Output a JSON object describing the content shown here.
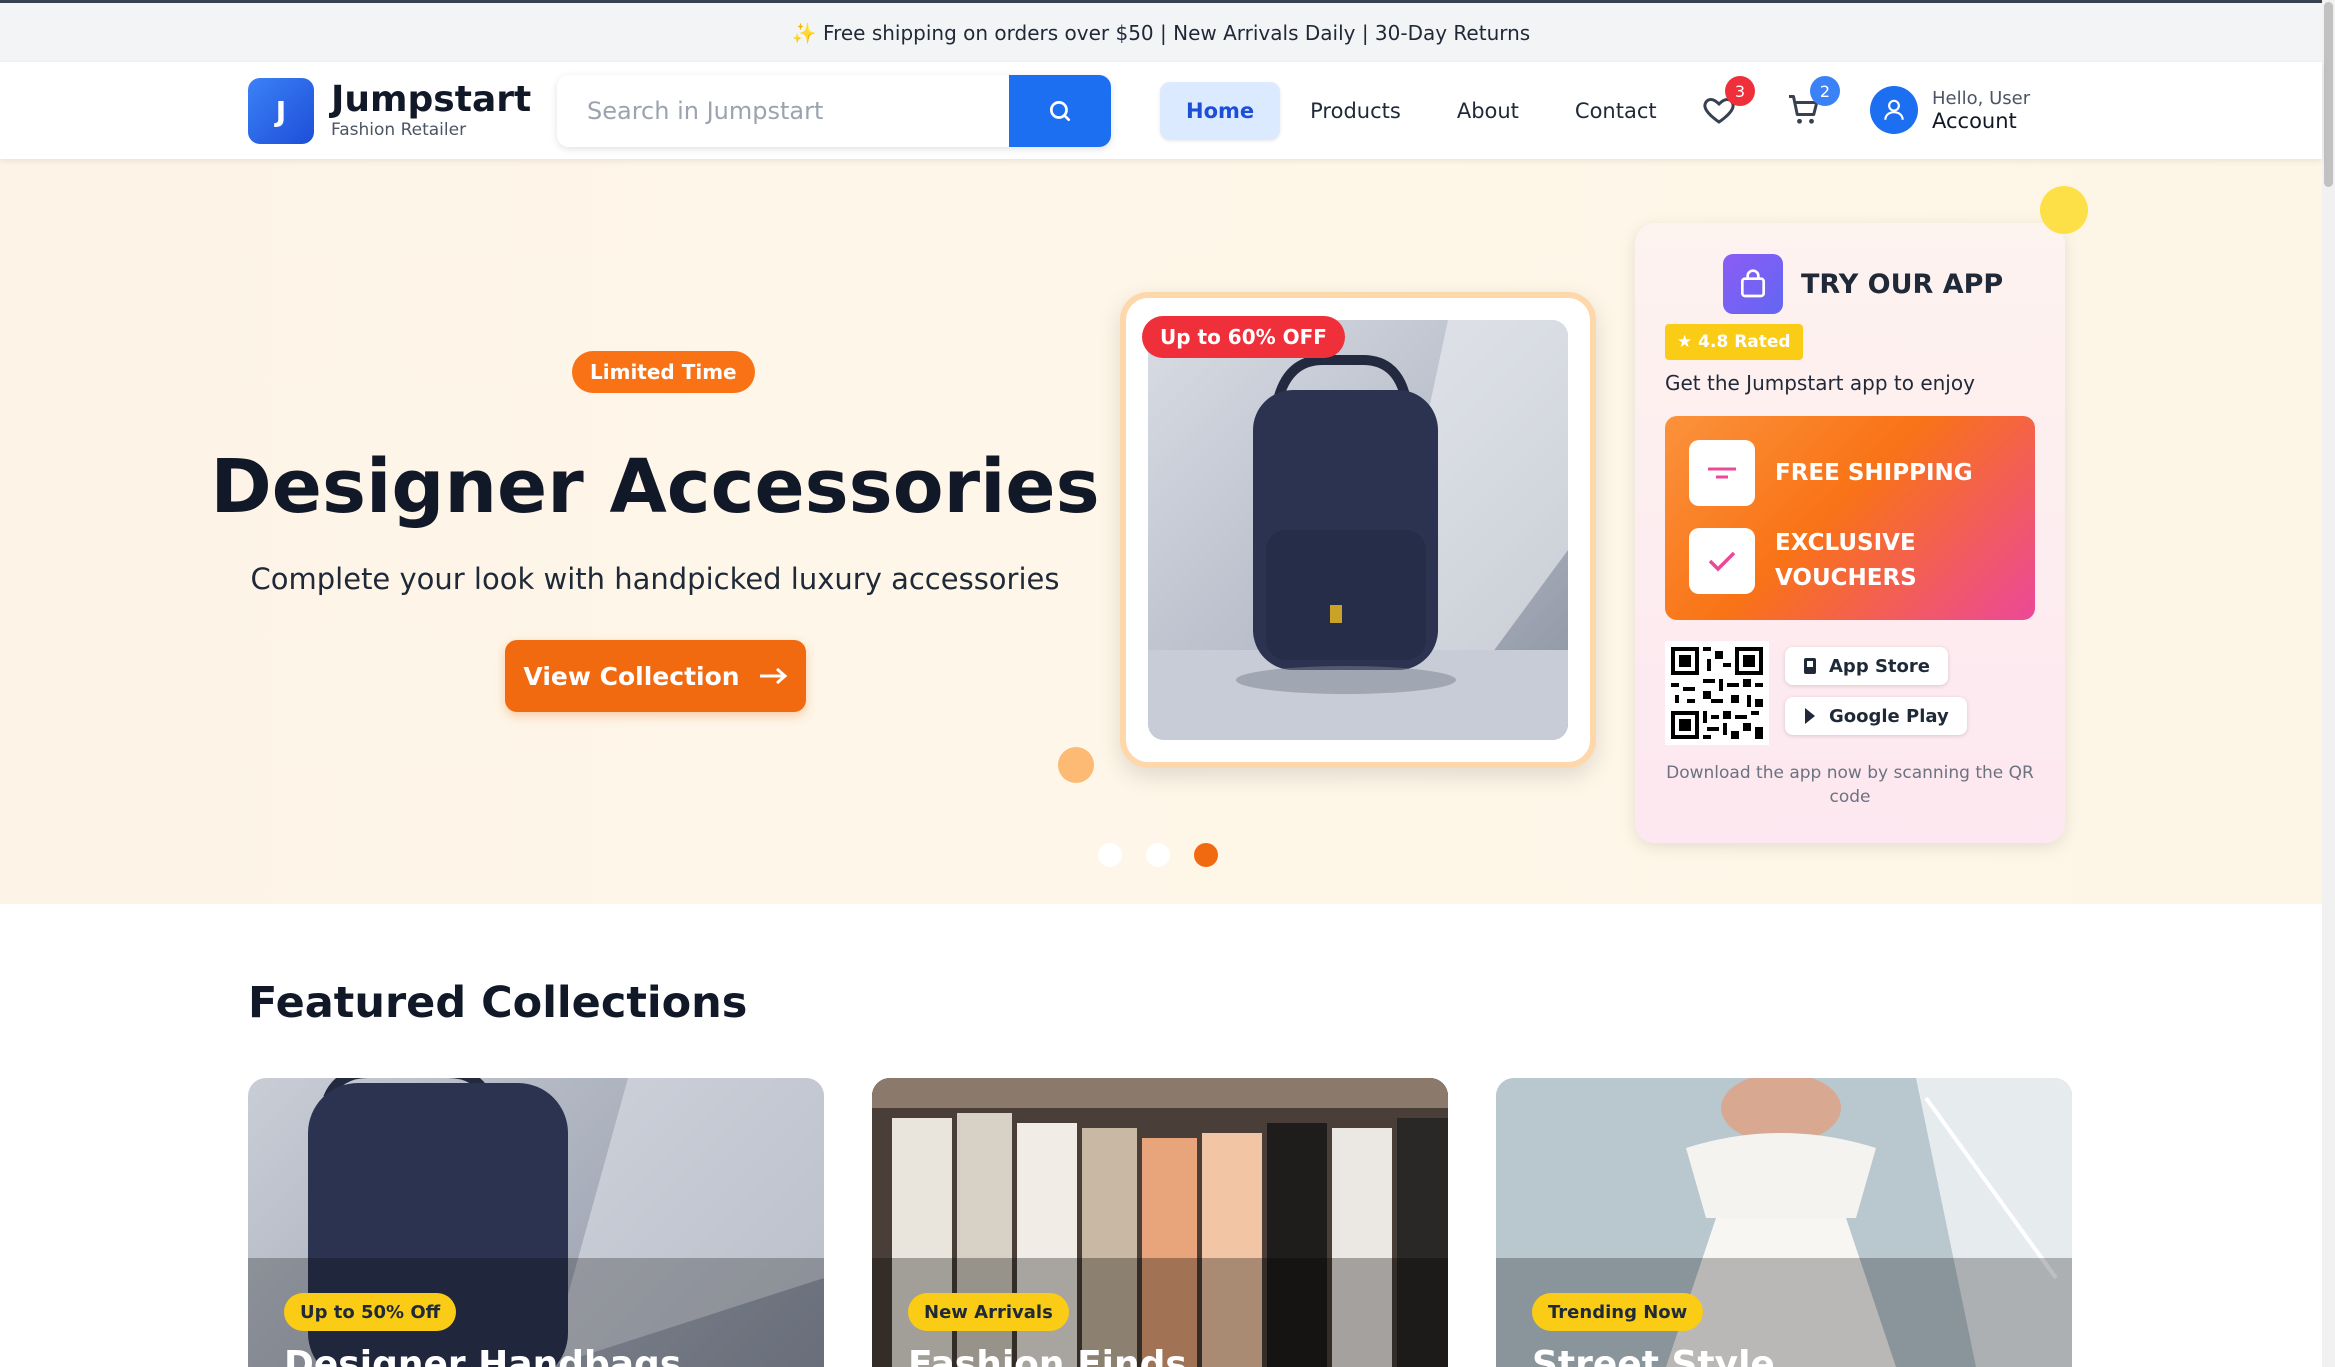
{
  "announcement": "✨ Free shipping on orders over $50 | New Arrivals Daily | 30-Day Returns",
  "brand": {
    "logo_letter": "J",
    "name": "Jumpstart",
    "tagline": "Fashion Retailer"
  },
  "search": {
    "placeholder": "Search in Jumpstart"
  },
  "nav": {
    "home": "Home",
    "products": "Products",
    "about": "About",
    "contact": "Contact"
  },
  "wishlist_count": "3",
  "cart_count": "2",
  "account": {
    "greeting": "Hello, User",
    "label": "Account"
  },
  "hero": {
    "badge": "Limited Time",
    "title": "Designer Accessories",
    "subtitle": "Complete your look with handpicked luxury accessories",
    "cta": "View Collection",
    "discount_tag": "Up to 60% OFF",
    "slides_total": 3,
    "active_slide": 3
  },
  "app_promo": {
    "title": "TRY OUR APP",
    "rating": "★ 4.8 Rated",
    "subtitle": "Get the Jumpstart app to enjoy",
    "perk1": "FREE SHIPPING",
    "perk2_line1": "EXCLUSIVE",
    "perk2_line2": "VOUCHERS",
    "app_store": "App Store",
    "google_play": "Google Play",
    "download_text": "Download the app now by scanning the QR code"
  },
  "featured": {
    "title": "Featured Collections",
    "cards": [
      {
        "badge": "Up to 50% Off",
        "name": "Designer Handbags"
      },
      {
        "badge": "New Arrivals",
        "name": "Fashion Finds"
      },
      {
        "badge": "Trending Now",
        "name": "Street Style"
      }
    ]
  },
  "colors": {
    "primary": "#1d6ff2",
    "accent": "#f26a0f",
    "badge_red": "#ef2f3a",
    "badge_blue": "#3b82f6",
    "yellow": "#facc15"
  }
}
